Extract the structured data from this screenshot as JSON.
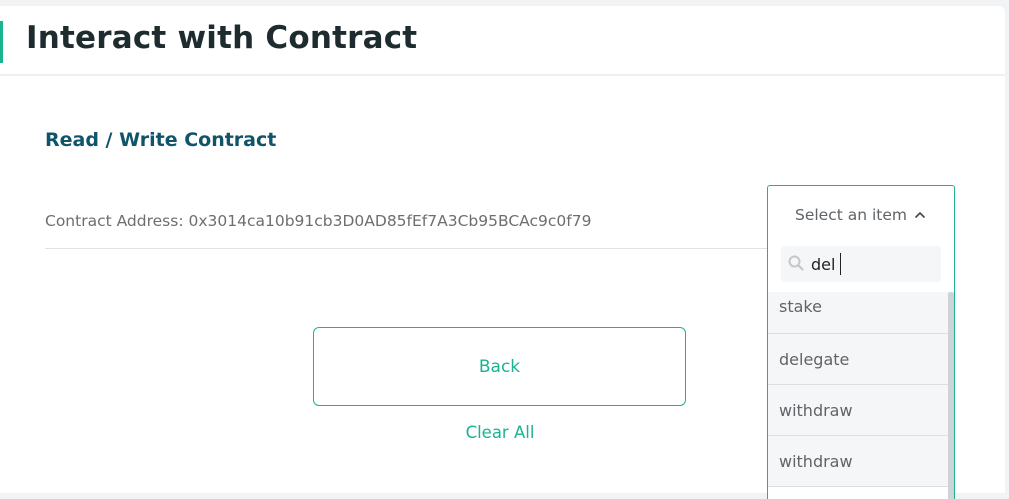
{
  "header": {
    "title": "Interact with Contract"
  },
  "section": {
    "title": "Read / Write Contract"
  },
  "contract": {
    "address_label": "Contract Address: 0x3014ca10b91cb3D0AD85fEf7A3Cb95BCAc9c0f79"
  },
  "dropdown": {
    "placeholder": "Select an item",
    "search_value": "del",
    "search_icon": "search-icon",
    "items": [
      {
        "label": "stake"
      },
      {
        "label": "delegate"
      },
      {
        "label": "withdraw"
      },
      {
        "label": "withdraw"
      }
    ]
  },
  "actions": {
    "back_label": "Back",
    "clear_label": "Clear All"
  },
  "colors": {
    "accent": "#1bb491",
    "section_title": "#10546a",
    "title": "#1e2b2f"
  }
}
